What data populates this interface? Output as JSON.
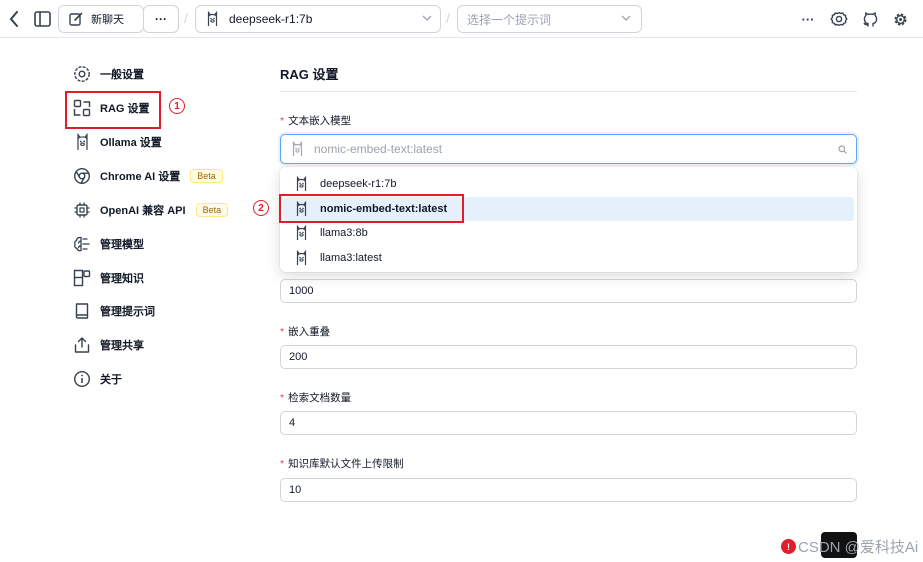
{
  "topbar": {
    "new_chat_label": "新聊天",
    "more_label": "···",
    "separator": "/",
    "model_value": "deepseek-r1:7b",
    "prompt_placeholder": "选择一个提示词",
    "right_more_label": "···"
  },
  "sidebar": {
    "items": [
      {
        "label": "一般设置",
        "icon": "gear-outline-icon"
      },
      {
        "label": "RAG 设置",
        "icon": "rag-icon"
      },
      {
        "label": "Ollama 设置",
        "icon": "llama-icon"
      },
      {
        "label": "Chrome AI 设置",
        "icon": "chrome-icon",
        "badge": "Beta"
      },
      {
        "label": "OpenAI 兼容 API",
        "icon": "chip-icon",
        "badge": "Beta"
      },
      {
        "label": "管理模型",
        "icon": "brain-icon"
      },
      {
        "label": "管理知识",
        "icon": "blocks-icon"
      },
      {
        "label": "管理提示词",
        "icon": "book-icon"
      },
      {
        "label": "管理共享",
        "icon": "share-icon"
      },
      {
        "label": "关于",
        "icon": "info-icon"
      }
    ]
  },
  "annotations": {
    "one": "1",
    "two": "2"
  },
  "main": {
    "title": "RAG 设置",
    "fields": {
      "embedding_label": "文本嵌入模型",
      "embedding_value": "nomic-embed-text:latest",
      "chunk_value": "1000",
      "overlap_label": "嵌入重叠",
      "overlap_value": "200",
      "docs_label": "检索文档数量",
      "docs_value": "4",
      "upload_label": "知识库默认文件上传限制",
      "upload_value": "10"
    },
    "dropdown": {
      "options": [
        "deepseek-r1:7b",
        "nomic-embed-text:latest",
        "llama3:8b",
        "llama3:latest"
      ],
      "selected_index": 1
    }
  },
  "watermark": {
    "text": "CSDN @爱科技Ai",
    "circle": "!"
  },
  "colors": {
    "accent_red": "#e11d2a",
    "focus_blue": "#60a5fa",
    "selected_bg": "#e6f0fb"
  }
}
